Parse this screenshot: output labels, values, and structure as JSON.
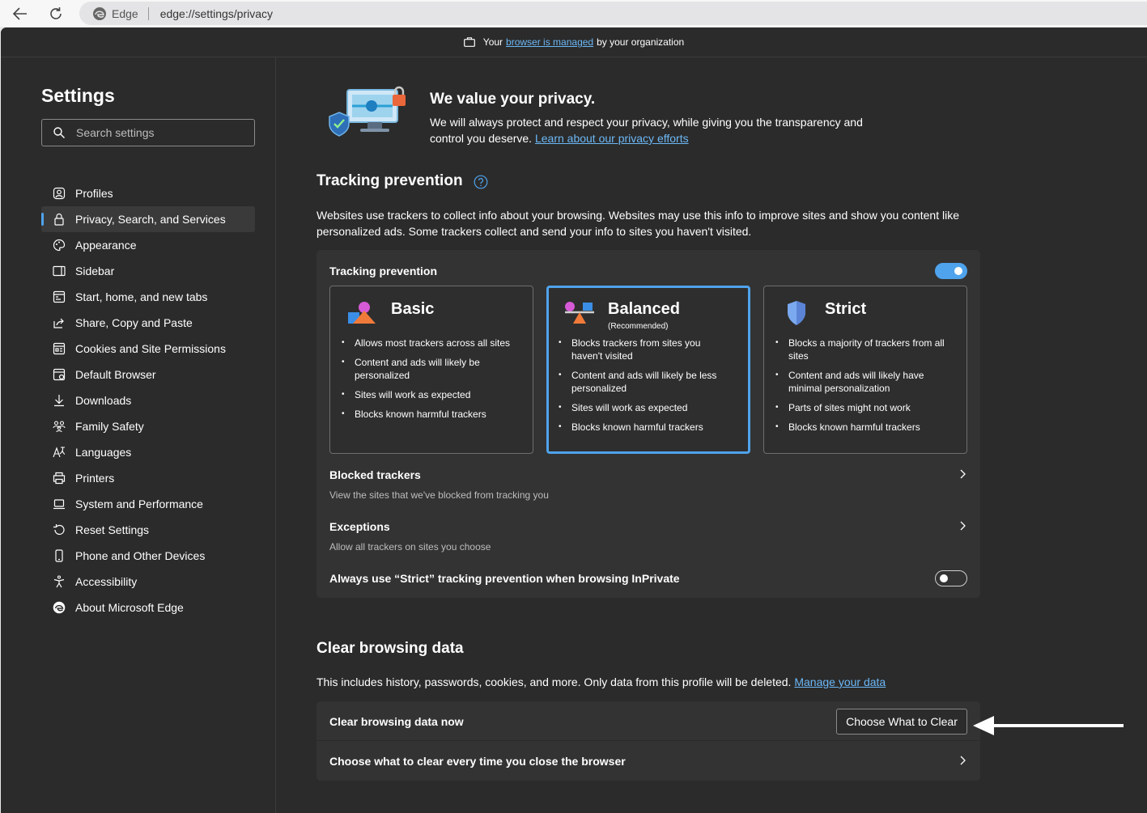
{
  "browser": {
    "name": "Edge",
    "url": "edge://settings/privacy"
  },
  "managed_bar": {
    "before": "Your",
    "link": "browser is managed",
    "after": "by your organization"
  },
  "sidebar": {
    "title": "Settings",
    "search_placeholder": "Search settings",
    "items": [
      {
        "label": "Profiles",
        "icon": "profile-icon"
      },
      {
        "label": "Privacy, Search, and Services",
        "icon": "lock-icon",
        "active": true
      },
      {
        "label": "Appearance",
        "icon": "palette-icon"
      },
      {
        "label": "Sidebar",
        "icon": "sidebar-icon"
      },
      {
        "label": "Start, home, and new tabs",
        "icon": "home-tabs-icon"
      },
      {
        "label": "Share, Copy and Paste",
        "icon": "share-icon"
      },
      {
        "label": "Cookies and Site Permissions",
        "icon": "cookies-icon"
      },
      {
        "label": "Default Browser",
        "icon": "default-browser-icon"
      },
      {
        "label": "Downloads",
        "icon": "download-icon"
      },
      {
        "label": "Family Safety",
        "icon": "family-icon"
      },
      {
        "label": "Languages",
        "icon": "languages-icon"
      },
      {
        "label": "Printers",
        "icon": "printer-icon"
      },
      {
        "label": "System and Performance",
        "icon": "laptop-icon"
      },
      {
        "label": "Reset Settings",
        "icon": "reset-icon"
      },
      {
        "label": "Phone and Other Devices",
        "icon": "phone-icon"
      },
      {
        "label": "Accessibility",
        "icon": "accessibility-icon"
      },
      {
        "label": "About Microsoft Edge",
        "icon": "edge-logo-icon"
      }
    ]
  },
  "hero": {
    "title": "We value your privacy.",
    "text": "We will always protect and respect your privacy, while giving you the transparency and control you deserve.",
    "link": "Learn about our privacy efforts"
  },
  "tracking": {
    "heading": "Tracking prevention",
    "description": "Websites use trackers to collect info about your browsing. Websites may use this info to improve sites and show you content like personalized ads. Some trackers collect and send your info to sites you haven't visited.",
    "card_title": "Tracking prevention",
    "enabled": true,
    "levels": [
      {
        "title": "Basic",
        "subtitle": "",
        "selected": false,
        "bullets": [
          "Allows most trackers across all sites",
          "Content and ads will likely be personalized",
          "Sites will work as expected",
          "Blocks known harmful trackers"
        ]
      },
      {
        "title": "Balanced",
        "subtitle": "(Recommended)",
        "selected": true,
        "bullets": [
          "Blocks trackers from sites you haven't visited",
          "Content and ads will likely be less personalized",
          "Sites will work as expected",
          "Blocks known harmful trackers"
        ]
      },
      {
        "title": "Strict",
        "subtitle": "",
        "selected": false,
        "bullets": [
          "Blocks a majority of trackers from all sites",
          "Content and ads will likely have minimal personalization",
          "Parts of sites might not work",
          "Blocks known harmful trackers"
        ]
      }
    ],
    "blocked_title": "Blocked trackers",
    "blocked_sub": "View the sites that we've blocked from tracking you",
    "exceptions_title": "Exceptions",
    "exceptions_sub": "Allow all trackers on sites you choose",
    "strict_inprivate": "Always use “Strict” tracking prevention when browsing InPrivate",
    "strict_inprivate_enabled": false
  },
  "clear": {
    "heading": "Clear browsing data",
    "description": "This includes history, passwords, cookies, and more. Only data from this profile will be deleted.",
    "link": "Manage your data",
    "now_label": "Clear browsing data now",
    "button": "Choose What to Clear",
    "on_close_label": "Choose what to clear every time you close the browser"
  },
  "colors": {
    "accent": "#4fa3ec",
    "background": "#2b2b2b",
    "card": "#333333"
  }
}
